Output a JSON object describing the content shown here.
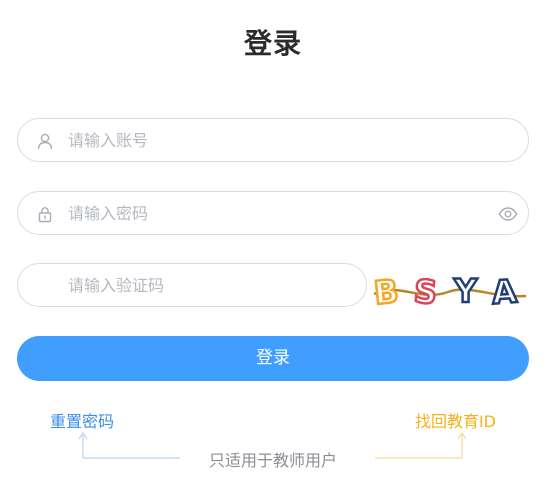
{
  "title": "登录",
  "account": {
    "placeholder": "请输入账号",
    "icon": "user-icon"
  },
  "password": {
    "placeholder": "请输入密码",
    "icon": "lock-icon",
    "toggle_icon": "eye-icon"
  },
  "captcha": {
    "placeholder": "请输入验证码",
    "image_text": "BSYA"
  },
  "login_button": "登录",
  "reset_password": "重置密码",
  "find_education_id": "找回教育ID",
  "hint": "只适用于教师用户",
  "colors": {
    "primary": "#409eff",
    "reset_link": "#3c8ee8",
    "find_id_link": "#f2b21a"
  }
}
